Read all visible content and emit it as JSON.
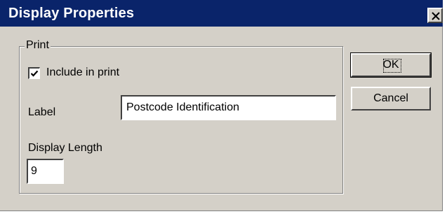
{
  "window": {
    "title": "Display Properties"
  },
  "print_group": {
    "label": "Print",
    "include_in_print": {
      "label": "Include in print",
      "checked": true
    },
    "label_field": {
      "label": "Label",
      "value": "Postcode Identification"
    },
    "display_length": {
      "label": "Display Length",
      "value": "9"
    }
  },
  "buttons": {
    "ok": "OK",
    "cancel": "Cancel"
  },
  "icons": {
    "close": "close-icon",
    "check": "checkmark-icon"
  },
  "colors": {
    "titlebar": "#0a246a",
    "dialog": "#d4d0c8"
  }
}
